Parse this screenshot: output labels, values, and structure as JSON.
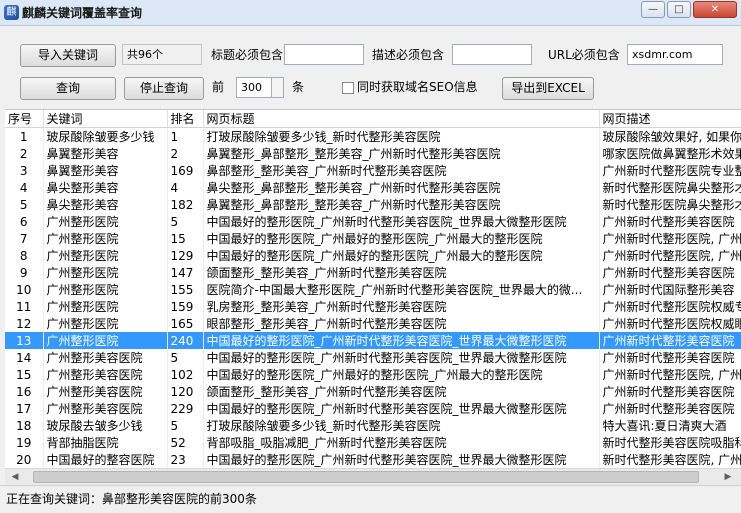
{
  "window": {
    "title": "麒麟关键词覆盖率查询",
    "app_icon": "app-logo-icon",
    "controls": {
      "minimize": "—",
      "maximize": "□",
      "close": "✕"
    }
  },
  "toolbar": {
    "import_label": "导入关键词",
    "count_value": "共96个",
    "title_label": "标题必须包含",
    "title_value": "",
    "desc_label": "描述必须包含",
    "desc_value": "",
    "url_label": "URL必须包含",
    "url_value": "xsdmr.com",
    "query_label": "查询",
    "stop_label": "停止查询",
    "front_label": "前",
    "top_value": "300",
    "unit_label": "条",
    "seo_label": "同时获取域名SEO信息",
    "seo_checked": false,
    "export_label": "导出到EXCEL"
  },
  "grid": {
    "columns": [
      "序号",
      "关键词",
      "排名",
      "网页标题",
      "网页描述"
    ],
    "selected_index": 12,
    "selection_color": "#3399ff",
    "rows": [
      {
        "no": "1",
        "keyword": "玻尿酸除皱要多少钱",
        "rank": "1",
        "title": "打玻尿酸除皱要多少钱_新时代整形美容医院",
        "desc": "玻尿酸除皱效果好, 如果你"
      },
      {
        "no": "2",
        "keyword": "鼻翼整形美容",
        "rank": "2",
        "title": "鼻翼整形_鼻部整形_整形美容_广州新时代整形美容医院",
        "desc": "哪家医院做鼻翼整形术效果"
      },
      {
        "no": "3",
        "keyword": "鼻翼整形美容",
        "rank": "169",
        "title": "鼻部整形_整形美容_广州新时代整形美容医院",
        "desc": "广州新时代整形医院专业整"
      },
      {
        "no": "4",
        "keyword": "鼻尖整形美容",
        "rank": "4",
        "title": "鼻尖整形_鼻部整形_整形美容_广州新时代整形美容医院",
        "desc": "新时代整形医院鼻尖整形才"
      },
      {
        "no": "5",
        "keyword": "鼻尖整形美容",
        "rank": "182",
        "title": "鼻翼整形_鼻部整形_整形美容_广州新时代整形美容医院",
        "desc": "新时代整形医院鼻尖整形才"
      },
      {
        "no": "6",
        "keyword": "广州整形医院",
        "rank": "5",
        "title": "中国最好的整形医院_广州新时代整形美容医院_世界最大微整形医院",
        "desc": "广州新时代整形美容医院"
      },
      {
        "no": "7",
        "keyword": "广州整形医院",
        "rank": "15",
        "title": "中国最好的整形医院_广州最好的整形医院_广州最大的整形医院",
        "desc": "广州新时代整形医院, 广州"
      },
      {
        "no": "8",
        "keyword": "广州整形医院",
        "rank": "129",
        "title": "中国最好的整形医院_广州最好的整形医院_广州最大的整形医院",
        "desc": "广州新时代整形医院, 广州"
      },
      {
        "no": "9",
        "keyword": "广州整形医院",
        "rank": "147",
        "title": "颌面整形_整形美容_广州新时代整形美容医院",
        "desc": "广州新时代整形美容医院"
      },
      {
        "no": "10",
        "keyword": "广州整形医院",
        "rank": "155",
        "title": "医院简介-中国最大整形医院_广州新时代整形美容医院_世界最大的微...",
        "desc": " 广州新时代国际整形美容"
      },
      {
        "no": "11",
        "keyword": "广州整形医院",
        "rank": "159",
        "title": "乳房整形_整形美容_广州新时代整形美容医院",
        "desc": "广州新时代整形医院权威专"
      },
      {
        "no": "12",
        "keyword": "广州整形医院",
        "rank": "165",
        "title": "眼部整形_整形美容_广州新时代整形美容医院",
        "desc": "广州新时代整形医院权威眼"
      },
      {
        "no": "13",
        "keyword": "广州整形医院",
        "rank": "240",
        "title": "中国最好的整形医院_广州新时代整形美容医院_世界最大微整形医院",
        "desc": "广州新时代整形美容医院"
      },
      {
        "no": "14",
        "keyword": "广州整形美容医院",
        "rank": "5",
        "title": "中国最好的整形医院_广州新时代整形美容医院_世界最大微整形医院",
        "desc": "广州新时代整形美容医院"
      },
      {
        "no": "15",
        "keyword": "广州整形美容医院",
        "rank": "102",
        "title": "中国最好的整形医院_广州最好的整形医院_广州最大的整形医院",
        "desc": "广州新时代整形医院, 广州"
      },
      {
        "no": "16",
        "keyword": "广州整形美容医院",
        "rank": "120",
        "title": "颌面整形_整形美容_广州新时代整形美容医院",
        "desc": "广州新时代整形美容医院"
      },
      {
        "no": "17",
        "keyword": "广州整形美容医院",
        "rank": "229",
        "title": "中国最好的整形医院_广州新时代整形美容医院_世界最大微整形医院",
        "desc": "广州新时代整形美容医院"
      },
      {
        "no": "18",
        "keyword": "玻尿酸去皱多少钱",
        "rank": "5",
        "title": "打玻尿酸除皱要多少钱_新时代整形美容医院",
        "desc": " 特大喜讯:夏日清爽大酒"
      },
      {
        "no": "19",
        "keyword": "背部抽脂医院",
        "rank": "52",
        "title": "背部吸脂_吸脂减肥_广州新时代整形美容医院",
        "desc": "新时代整形美容医院吸脂科"
      },
      {
        "no": "20",
        "keyword": "中国最好的整容医院",
        "rank": "23",
        "title": "中国最好的整形医院_广州新时代整形美容医院_世界最大微整形医院",
        "desc": "新时代整形美容医院, 广州"
      }
    ]
  },
  "scrollbar": {
    "left_icon": "scroll-left-arrow-icon",
    "right_icon": "scroll-right-arrow-icon"
  },
  "status": {
    "text": "正在查询关键词：鼻部整形美容医院的前300条"
  }
}
